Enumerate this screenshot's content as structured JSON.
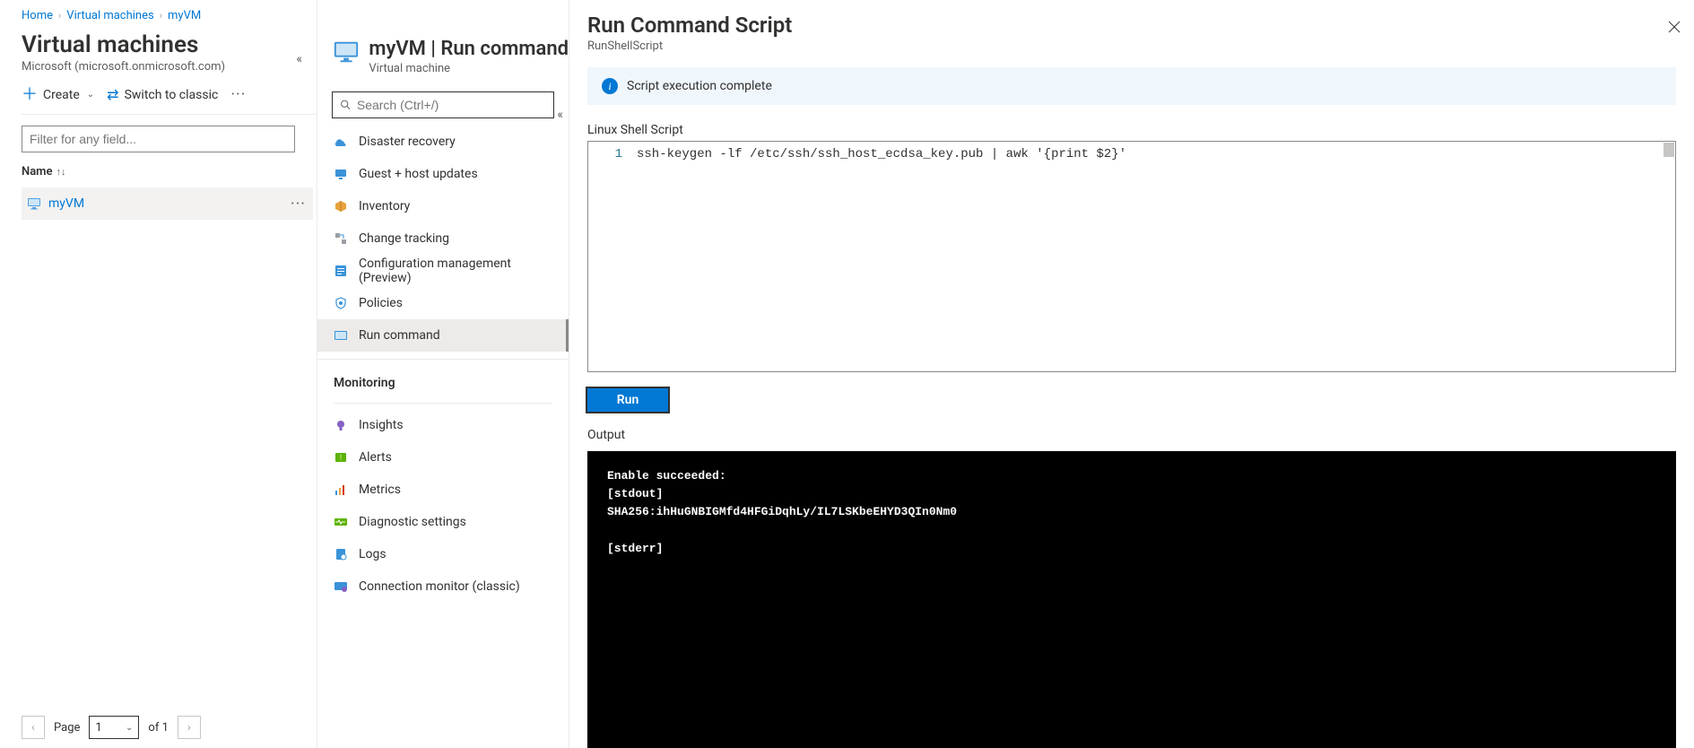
{
  "breadcrumb": {
    "home": "Home",
    "vms": "Virtual machines",
    "vm": "myVM"
  },
  "col1": {
    "title": "Virtual machines",
    "subtitle": "Microsoft (microsoft.onmicrosoft.com)",
    "create_label": "Create",
    "switch_label": "Switch to classic",
    "filter_placeholder": "Filter for any field...",
    "column_header": "Name",
    "rows": [
      {
        "name": "myVM"
      }
    ],
    "pager": {
      "page_label": "Page",
      "current": "1",
      "of_label": "of 1"
    }
  },
  "col2": {
    "title": "myVM | Run command",
    "subtitle": "Virtual machine",
    "search_placeholder": "Search (Ctrl+/)",
    "ops_items": [
      {
        "label": "Disaster recovery"
      },
      {
        "label": "Guest + host updates"
      },
      {
        "label": "Inventory"
      },
      {
        "label": "Change tracking"
      },
      {
        "label": "Configuration management (Preview)"
      },
      {
        "label": "Policies"
      },
      {
        "label": "Run command",
        "selected": true
      }
    ],
    "monitoring_title": "Monitoring",
    "mon_items": [
      {
        "label": "Insights"
      },
      {
        "label": "Alerts"
      },
      {
        "label": "Metrics"
      },
      {
        "label": "Diagnostic settings"
      },
      {
        "label": "Logs"
      },
      {
        "label": "Connection monitor (classic)"
      }
    ]
  },
  "panel": {
    "title": "Run Command Script",
    "subtitle": "RunShellScript",
    "banner": "Script execution complete",
    "script_label": "Linux Shell Script",
    "line_no": "1",
    "code": "ssh-keygen -lf /etc/ssh/ssh_host_ecdsa_key.pub | awk '{print $2}'",
    "run_label": "Run",
    "output_label": "Output",
    "console": "Enable succeeded: \n[stdout]\nSHA256:ihHuGNBIGMfd4HFGiDqhLy/IL7LSKbeEHYD3QIn0Nm0\n\n[stderr]"
  },
  "colors": {
    "accent": "#0078d4"
  }
}
